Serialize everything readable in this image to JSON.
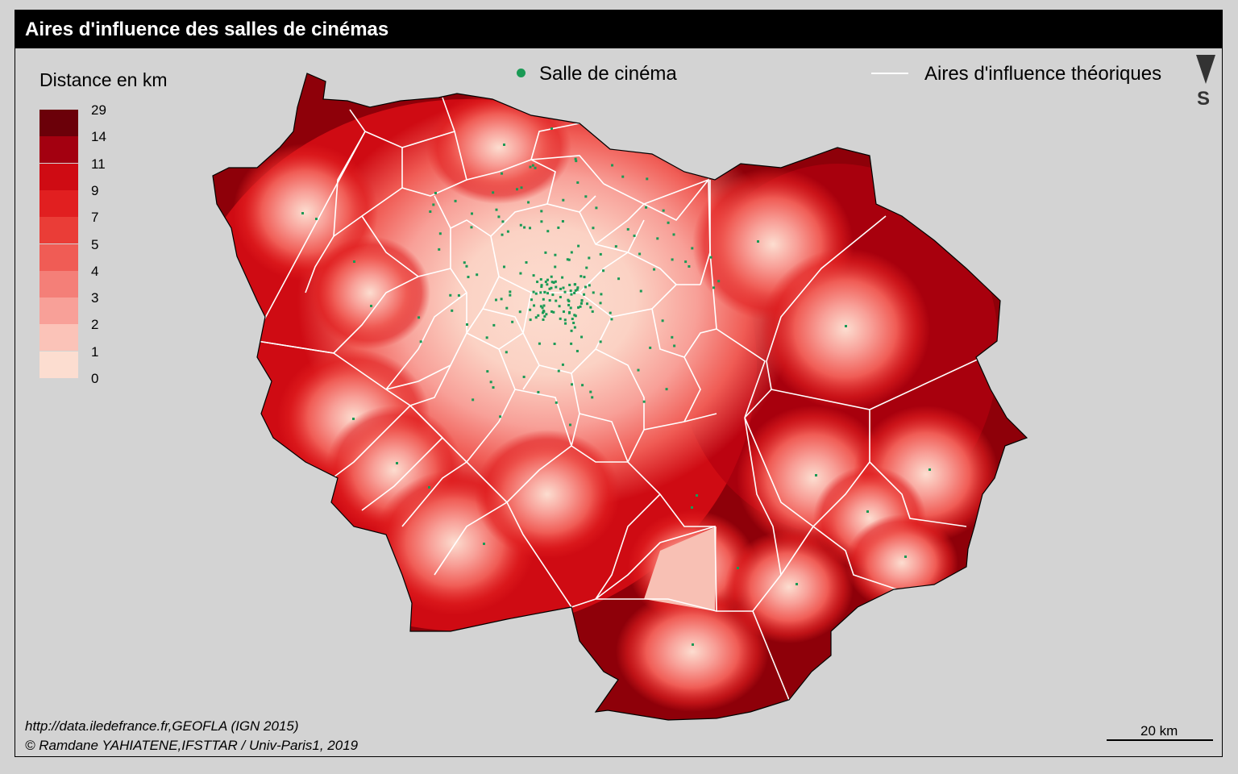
{
  "title": "Aires d'influence des salles de cinémas",
  "legend": {
    "title": "Distance en km",
    "classes": [
      {
        "label": "29",
        "color": "#6b0009"
      },
      {
        "label": "14",
        "color": "#a30010"
      },
      {
        "label": "11",
        "color": "#cf0b13"
      },
      {
        "label": "9",
        "color": "#e11f20"
      },
      {
        "label": "7",
        "color": "#ea3d37"
      },
      {
        "label": "5",
        "color": "#f05c55"
      },
      {
        "label": "4",
        "color": "#f47f78"
      },
      {
        "label": "3",
        "color": "#f8a098"
      },
      {
        "label": "2",
        "color": "#fbc3b8"
      },
      {
        "label": "1",
        "color": "#fcddd0"
      },
      {
        "label": "0",
        "color": ""
      }
    ]
  },
  "symbols": {
    "cinema_label": "Salle de cinéma",
    "cinema_color": "#1a9a55",
    "areas_label": "Aires d'influence théoriques",
    "areas_color": "#ffffff"
  },
  "north_arrow": {
    "letter": "S"
  },
  "source": {
    "line1": "http://data.iledefrance.fr,GEOFLA (IGN 2015)",
    "line2": "© Ramdane YAHIATENE,IFSTTAR / Univ-Paris1, 2019"
  },
  "scale": {
    "label": "20 km"
  }
}
